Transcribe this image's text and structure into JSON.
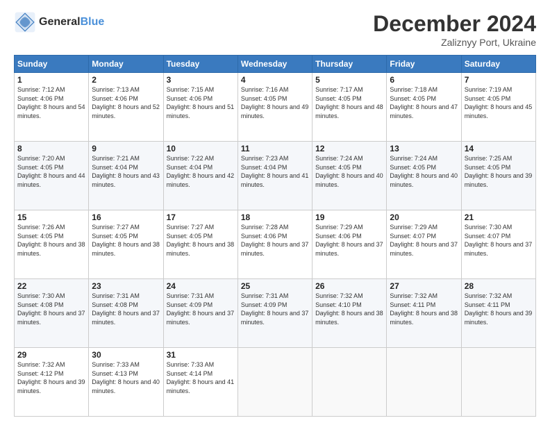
{
  "header": {
    "logo_line1": "General",
    "logo_line2": "Blue",
    "month": "December 2024",
    "location": "Zaliznyy Port, Ukraine"
  },
  "days_of_week": [
    "Sunday",
    "Monday",
    "Tuesday",
    "Wednesday",
    "Thursday",
    "Friday",
    "Saturday"
  ],
  "weeks": [
    [
      {
        "day": "1",
        "sunrise": "7:12 AM",
        "sunset": "4:06 PM",
        "daylight": "8 hours and 54 minutes."
      },
      {
        "day": "2",
        "sunrise": "7:13 AM",
        "sunset": "4:06 PM",
        "daylight": "8 hours and 52 minutes."
      },
      {
        "day": "3",
        "sunrise": "7:15 AM",
        "sunset": "4:06 PM",
        "daylight": "8 hours and 51 minutes."
      },
      {
        "day": "4",
        "sunrise": "7:16 AM",
        "sunset": "4:05 PM",
        "daylight": "8 hours and 49 minutes."
      },
      {
        "day": "5",
        "sunrise": "7:17 AM",
        "sunset": "4:05 PM",
        "daylight": "8 hours and 48 minutes."
      },
      {
        "day": "6",
        "sunrise": "7:18 AM",
        "sunset": "4:05 PM",
        "daylight": "8 hours and 47 minutes."
      },
      {
        "day": "7",
        "sunrise": "7:19 AM",
        "sunset": "4:05 PM",
        "daylight": "8 hours and 45 minutes."
      }
    ],
    [
      {
        "day": "8",
        "sunrise": "7:20 AM",
        "sunset": "4:05 PM",
        "daylight": "8 hours and 44 minutes."
      },
      {
        "day": "9",
        "sunrise": "7:21 AM",
        "sunset": "4:04 PM",
        "daylight": "8 hours and 43 minutes."
      },
      {
        "day": "10",
        "sunrise": "7:22 AM",
        "sunset": "4:04 PM",
        "daylight": "8 hours and 42 minutes."
      },
      {
        "day": "11",
        "sunrise": "7:23 AM",
        "sunset": "4:04 PM",
        "daylight": "8 hours and 41 minutes."
      },
      {
        "day": "12",
        "sunrise": "7:24 AM",
        "sunset": "4:05 PM",
        "daylight": "8 hours and 40 minutes."
      },
      {
        "day": "13",
        "sunrise": "7:24 AM",
        "sunset": "4:05 PM",
        "daylight": "8 hours and 40 minutes."
      },
      {
        "day": "14",
        "sunrise": "7:25 AM",
        "sunset": "4:05 PM",
        "daylight": "8 hours and 39 minutes."
      }
    ],
    [
      {
        "day": "15",
        "sunrise": "7:26 AM",
        "sunset": "4:05 PM",
        "daylight": "8 hours and 38 minutes."
      },
      {
        "day": "16",
        "sunrise": "7:27 AM",
        "sunset": "4:05 PM",
        "daylight": "8 hours and 38 minutes."
      },
      {
        "day": "17",
        "sunrise": "7:27 AM",
        "sunset": "4:05 PM",
        "daylight": "8 hours and 38 minutes."
      },
      {
        "day": "18",
        "sunrise": "7:28 AM",
        "sunset": "4:06 PM",
        "daylight": "8 hours and 37 minutes."
      },
      {
        "day": "19",
        "sunrise": "7:29 AM",
        "sunset": "4:06 PM",
        "daylight": "8 hours and 37 minutes."
      },
      {
        "day": "20",
        "sunrise": "7:29 AM",
        "sunset": "4:07 PM",
        "daylight": "8 hours and 37 minutes."
      },
      {
        "day": "21",
        "sunrise": "7:30 AM",
        "sunset": "4:07 PM",
        "daylight": "8 hours and 37 minutes."
      }
    ],
    [
      {
        "day": "22",
        "sunrise": "7:30 AM",
        "sunset": "4:08 PM",
        "daylight": "8 hours and 37 minutes."
      },
      {
        "day": "23",
        "sunrise": "7:31 AM",
        "sunset": "4:08 PM",
        "daylight": "8 hours and 37 minutes."
      },
      {
        "day": "24",
        "sunrise": "7:31 AM",
        "sunset": "4:09 PM",
        "daylight": "8 hours and 37 minutes."
      },
      {
        "day": "25",
        "sunrise": "7:31 AM",
        "sunset": "4:09 PM",
        "daylight": "8 hours and 37 minutes."
      },
      {
        "day": "26",
        "sunrise": "7:32 AM",
        "sunset": "4:10 PM",
        "daylight": "8 hours and 38 minutes."
      },
      {
        "day": "27",
        "sunrise": "7:32 AM",
        "sunset": "4:11 PM",
        "daylight": "8 hours and 38 minutes."
      },
      {
        "day": "28",
        "sunrise": "7:32 AM",
        "sunset": "4:11 PM",
        "daylight": "8 hours and 39 minutes."
      }
    ],
    [
      {
        "day": "29",
        "sunrise": "7:32 AM",
        "sunset": "4:12 PM",
        "daylight": "8 hours and 39 minutes."
      },
      {
        "day": "30",
        "sunrise": "7:33 AM",
        "sunset": "4:13 PM",
        "daylight": "8 hours and 40 minutes."
      },
      {
        "day": "31",
        "sunrise": "7:33 AM",
        "sunset": "4:14 PM",
        "daylight": "8 hours and 41 minutes."
      },
      null,
      null,
      null,
      null
    ]
  ],
  "labels": {
    "sunrise": "Sunrise:",
    "sunset": "Sunset:",
    "daylight": "Daylight:"
  }
}
